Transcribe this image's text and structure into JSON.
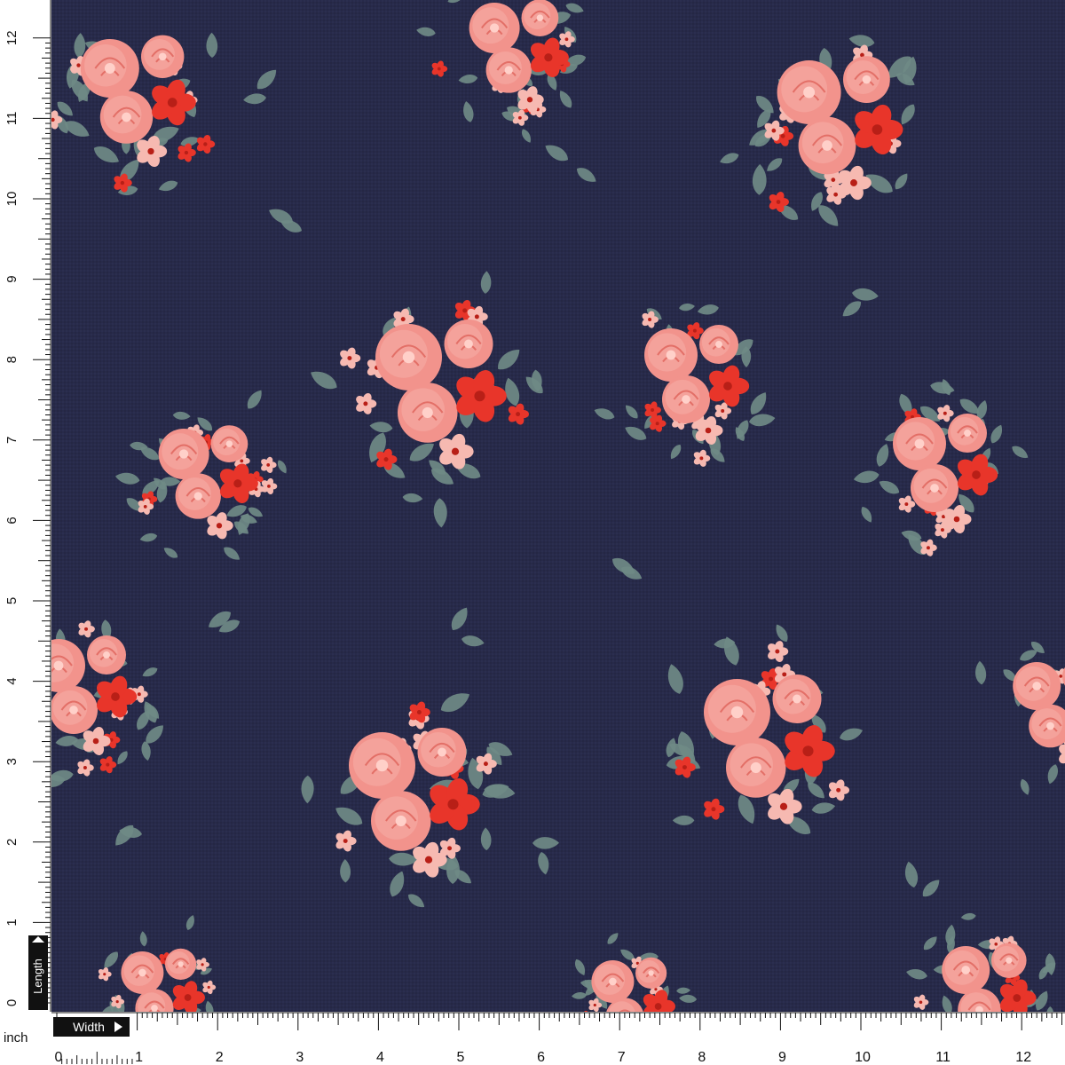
{
  "swatch": {
    "background_color": "#272a4a",
    "motif_colors": {
      "rose_pink": "#f2938c",
      "coral_red": "#e8352a",
      "blush": "#f6b9b1",
      "leaf_gray": "#6f8a86"
    }
  },
  "ruler_vertical": {
    "label": "Length",
    "numbers": [
      "0",
      "1",
      "2",
      "3",
      "4",
      "5",
      "6",
      "7",
      "8",
      "9",
      "10",
      "11",
      "12"
    ]
  },
  "ruler_horizontal": {
    "unit": "inch",
    "label": "Width",
    "numbers": [
      "0",
      "1",
      "2",
      "3",
      "4",
      "5",
      "6",
      "7",
      "8",
      "9",
      "10",
      "11",
      "12"
    ]
  }
}
